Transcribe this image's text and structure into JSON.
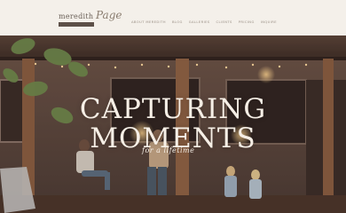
{
  "logo": {
    "name": "meredith",
    "script": "Page"
  },
  "nav": {
    "items": [
      {
        "label": "ABOUT MEREDITH"
      },
      {
        "label": "BLOG"
      },
      {
        "label": "GALLERIES"
      },
      {
        "label": "CLIENTS"
      },
      {
        "label": "PRICING"
      },
      {
        "label": "INQUIRE"
      }
    ]
  },
  "hero": {
    "title_line1": "CAPTURING",
    "title_line2": "MOMENTS",
    "script": "for a lifetime"
  },
  "colors": {
    "background": "#f4f0ea",
    "logo_bar": "#5d5048",
    "hero_text": "#f6efe6"
  }
}
